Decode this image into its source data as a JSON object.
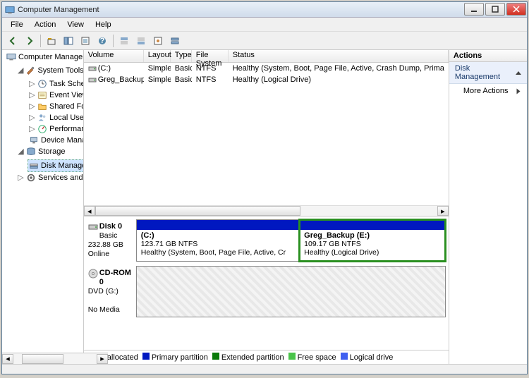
{
  "title": "Computer Management",
  "menus": {
    "file": "File",
    "action": "Action",
    "view": "View",
    "help": "Help"
  },
  "tree": {
    "root": "Computer Management (Local",
    "system_tools": "System Tools",
    "task_scheduler": "Task Scheduler",
    "event_viewer": "Event Viewer",
    "shared_folders": "Shared Folders",
    "local_users": "Local Users and Groups",
    "performance": "Performance",
    "device_manager": "Device Manager",
    "storage": "Storage",
    "disk_management": "Disk Management",
    "services_apps": "Services and Applications"
  },
  "volcols": {
    "volume": "Volume",
    "layout": "Layout",
    "type": "Type",
    "fs": "File System",
    "status": "Status"
  },
  "volumes": [
    {
      "name": "(C:)",
      "layout": "Simple",
      "type": "Basic",
      "fs": "NTFS",
      "status": "Healthy (System, Boot, Page File, Active, Crash Dump, Prima"
    },
    {
      "name": "Greg_Backup (E:)",
      "layout": "Simple",
      "type": "Basic",
      "fs": "NTFS",
      "status": "Healthy (Logical Drive)"
    }
  ],
  "disks": [
    {
      "name": "Disk 0",
      "kind": "Basic",
      "size": "232.88 GB",
      "state": "Online",
      "parts": [
        {
          "label": "(C:)",
          "size": "123.71 GB NTFS",
          "status": "Healthy (System, Boot, Page File, Active, Cr",
          "cls": "primary",
          "selected": false,
          "flex": 53
        },
        {
          "label": "Greg_Backup  (E:)",
          "size": "109.17 GB NTFS",
          "status": "Healthy (Logical Drive)",
          "cls": "logical",
          "selected": true,
          "flex": 47
        }
      ]
    },
    {
      "name": "CD-ROM 0",
      "kind": "DVD (G:)",
      "size": "",
      "state": "No Media",
      "parts": []
    }
  ],
  "legend": {
    "unallocated": "Unallocated",
    "primary": "Primary partition",
    "extended": "Extended partition",
    "free": "Free space",
    "logical": "Logical drive"
  },
  "actions": {
    "header": "Actions",
    "section": "Disk Management",
    "more": "More Actions"
  }
}
